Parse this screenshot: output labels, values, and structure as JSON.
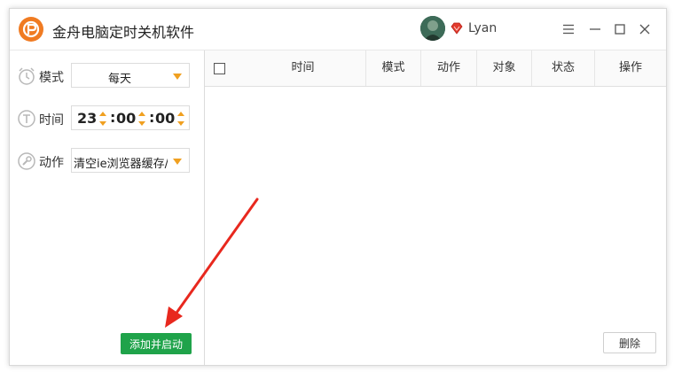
{
  "app": {
    "title": "金舟电脑定时关机软件"
  },
  "user": {
    "name": "Lyan"
  },
  "form": {
    "mode_label": "模式",
    "mode_value": "每天",
    "time_label": "时间",
    "time_hours": "23",
    "time_minutes": "00",
    "time_seconds": "00",
    "time_sep": ":",
    "action_label": "动作",
    "action_value": "清空ie浏览器缓存/..."
  },
  "buttons": {
    "add_start": "添加并启动",
    "delete": "删除"
  },
  "table": {
    "columns": [
      "时间",
      "模式",
      "动作",
      "对象",
      "状态",
      "操作"
    ],
    "rows": []
  },
  "colors": {
    "accent_orange": "#f07b22",
    "caret": "#f0a020",
    "primary_green": "#1fa34a",
    "annotation_red": "#e8281e"
  }
}
